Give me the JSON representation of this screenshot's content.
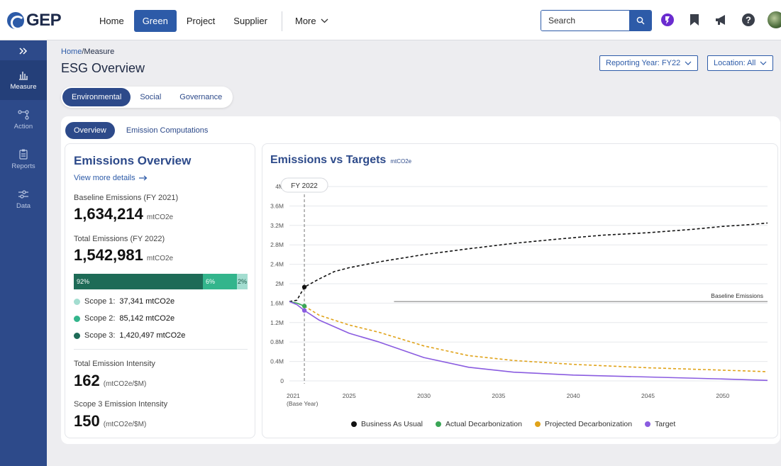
{
  "app": {
    "logo_text": "GEP",
    "nav": [
      "Home",
      "Green",
      "Project",
      "Supplier"
    ],
    "nav_more": "More",
    "search_placeholder": "Search"
  },
  "sidebar": {
    "items": [
      {
        "label": "Measure",
        "icon": "bar-chart-icon"
      },
      {
        "label": "Action",
        "icon": "flow-icon"
      },
      {
        "label": "Reports",
        "icon": "clipboard-icon"
      },
      {
        "label": "Data",
        "icon": "sliders-icon"
      }
    ]
  },
  "page": {
    "breadcrumb_home": "Home",
    "breadcrumb_sep": "/",
    "breadcrumb_current": "Measure",
    "title": "ESG Overview",
    "reporting_year": "Reporting Year: FY22",
    "location": "Location: All",
    "tabs": [
      "Environmental",
      "Social",
      "Governance"
    ],
    "subtabs": [
      "Overview",
      "Emission Computations"
    ]
  },
  "emissions_overview": {
    "title": "Emissions Overview",
    "view_more": "View more details",
    "baseline_label": "Baseline Emissions (FY 2021)",
    "baseline_value": "1,634,214",
    "baseline_unit": "mtCO2e",
    "total_label": "Total Emissions (FY 2022)",
    "total_value": "1,542,981",
    "total_unit": "mtCO2e",
    "bar": [
      {
        "label": "92%",
        "pct": 92,
        "color": "#1e6b57"
      },
      {
        "label": "6%",
        "pct": 6,
        "color": "#33b58c"
      },
      {
        "label": "2%",
        "pct": 2,
        "color": "#a3ddd0"
      }
    ],
    "scopes": [
      {
        "label": "Scope 1:",
        "value": "37,341 mtCO2e",
        "color": "#a3ddd0"
      },
      {
        "label": "Scope 2:",
        "value": "85,142 mtCO2e",
        "color": "#33b58c"
      },
      {
        "label": "Scope 3:",
        "value": "1,420,497 mtCO2e",
        "color": "#1e6b57"
      }
    ],
    "intensity_label": "Total Emission Intensity",
    "intensity_value": "162",
    "intensity_unit": "(mtCO2e/$M)",
    "scope3_intensity_label": "Scope 3 Emission Intensity",
    "scope3_intensity_value": "150",
    "scope3_intensity_unit": "(mtCO2e/$M)"
  },
  "chart_data": {
    "type": "line",
    "title": "Emissions vs Targets",
    "unit": "mtCO2e",
    "y_ticks": [
      "0",
      "0.4M",
      "0.8M",
      "1.2M",
      "1.6M",
      "2M",
      "2.4M",
      "2.8M",
      "3.2M",
      "3.6M",
      "4M"
    ],
    "ylim": [
      0,
      4
    ],
    "x_ticks": [
      {
        "x": 2021,
        "label": "2021",
        "sub": "(Base Year)"
      },
      {
        "x": 2025,
        "label": "2025",
        "sub": ""
      },
      {
        "x": 2030,
        "label": "2030",
        "sub": ""
      },
      {
        "x": 2035,
        "label": "2035",
        "sub": ""
      },
      {
        "x": 2040,
        "label": "2040",
        "sub": ""
      },
      {
        "x": 2045,
        "label": "2045",
        "sub": ""
      },
      {
        "x": 2050,
        "label": "2050",
        "sub": ""
      }
    ],
    "xlim": [
      2021,
      2053
    ],
    "marker_year": 2022,
    "marker_label": "FY 2022",
    "baseline": {
      "value": 1.634,
      "label": "Baseline Emissions",
      "x_start": 2028
    },
    "series": [
      {
        "name": "Business As Usual",
        "color": "#111111",
        "dash": "4,3",
        "points": [
          [
            2021,
            1.634
          ],
          [
            2021.5,
            1.66
          ],
          [
            2022,
            1.93
          ],
          [
            2023,
            2.1
          ],
          [
            2024,
            2.25
          ],
          [
            2025,
            2.33
          ],
          [
            2027,
            2.45
          ],
          [
            2030,
            2.6
          ],
          [
            2033,
            2.72
          ],
          [
            2036,
            2.83
          ],
          [
            2039,
            2.92
          ],
          [
            2042,
            3.0
          ],
          [
            2045,
            3.05
          ],
          [
            2048,
            3.12
          ],
          [
            2050,
            3.18
          ],
          [
            2052,
            3.22
          ],
          [
            2053,
            3.25
          ]
        ]
      },
      {
        "name": "Actual Decarbonization",
        "color": "#3aa556",
        "dash": "",
        "points": [
          [
            2021,
            1.634
          ],
          [
            2021.5,
            1.6
          ],
          [
            2022,
            1.54
          ]
        ]
      },
      {
        "name": "Projected Decarbonization",
        "color": "#e0a31a",
        "dash": "4,3",
        "points": [
          [
            2022,
            1.54
          ],
          [
            2023,
            1.35
          ],
          [
            2025,
            1.15
          ],
          [
            2027,
            1.0
          ],
          [
            2030,
            0.72
          ],
          [
            2033,
            0.52
          ],
          [
            2036,
            0.42
          ],
          [
            2040,
            0.34
          ],
          [
            2045,
            0.27
          ],
          [
            2050,
            0.22
          ],
          [
            2053,
            0.19
          ]
        ]
      },
      {
        "name": "Target",
        "color": "#8a5ce0",
        "dash": "",
        "points": [
          [
            2021,
            1.634
          ],
          [
            2021.5,
            1.57
          ],
          [
            2022,
            1.45
          ],
          [
            2023,
            1.25
          ],
          [
            2025,
            0.98
          ],
          [
            2027,
            0.8
          ],
          [
            2030,
            0.48
          ],
          [
            2033,
            0.28
          ],
          [
            2036,
            0.18
          ],
          [
            2040,
            0.12
          ],
          [
            2045,
            0.08
          ],
          [
            2050,
            0.04
          ],
          [
            2053,
            0.01
          ]
        ]
      }
    ],
    "point_markers": [
      {
        "year": 2022,
        "value": 1.93,
        "color": "#111111"
      },
      {
        "year": 2022,
        "value": 1.54,
        "color": "#3aa556"
      },
      {
        "year": 2022,
        "value": 1.45,
        "color": "#8a5ce0"
      }
    ]
  }
}
